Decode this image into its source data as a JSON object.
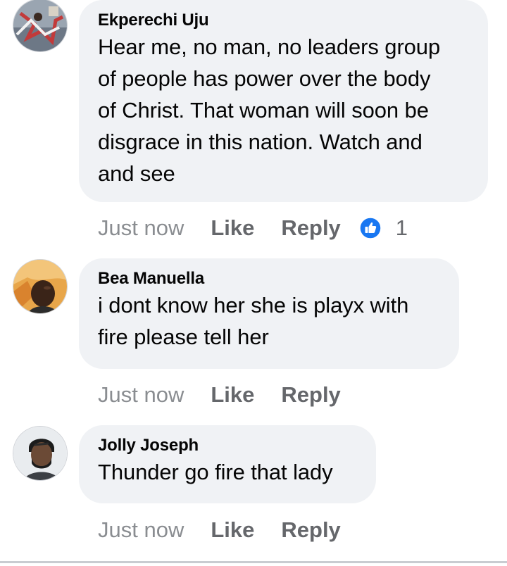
{
  "comments": [
    {
      "author": "Ekperechi Uju",
      "text_lines": [
        "Hear me, no man, no leaders group",
        "of people has power over the body",
        "of Christ. That woman will soon be",
        "disgrace in this nation. Watch and",
        "and see"
      ],
      "time": "Just now",
      "like_label": "Like",
      "reply_label": "Reply",
      "reaction_icon": "thumbs-up-icon",
      "reaction_count": "1"
    },
    {
      "author": "Bea Manuella",
      "text_lines": [
        "i dont know her she is playx with",
        "fire please tell her"
      ],
      "time": "Just now",
      "like_label": "Like",
      "reply_label": "Reply"
    },
    {
      "author": "Jolly Joseph",
      "text_lines": [
        "Thunder go fire that lady"
      ],
      "time": "Just now",
      "like_label": "Like",
      "reply_label": "Reply"
    }
  ],
  "colors": {
    "bubble": "#f0f2f5",
    "meta_text": "#65676b",
    "like_blue": "#1877f2"
  }
}
